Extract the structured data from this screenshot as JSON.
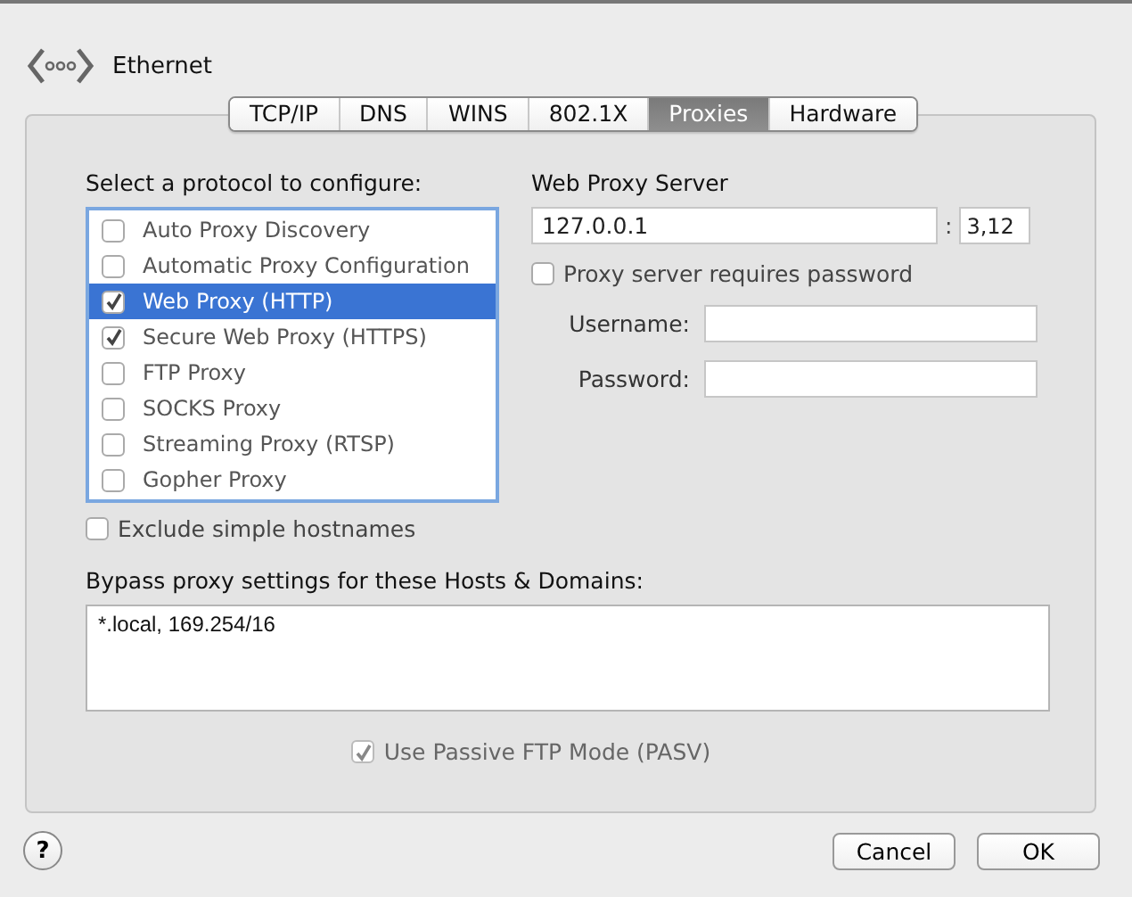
{
  "header": {
    "title": "Ethernet"
  },
  "tabs": [
    {
      "label": "TCP/IP",
      "selected": false
    },
    {
      "label": "DNS",
      "selected": false
    },
    {
      "label": "WINS",
      "selected": false
    },
    {
      "label": "802.1X",
      "selected": false
    },
    {
      "label": "Proxies",
      "selected": true
    },
    {
      "label": "Hardware",
      "selected": false
    }
  ],
  "protocols": {
    "label": "Select a protocol to configure:",
    "items": [
      {
        "label": "Auto Proxy Discovery",
        "checked": false,
        "selected": false
      },
      {
        "label": "Automatic Proxy Configuration",
        "checked": false,
        "selected": false
      },
      {
        "label": "Web Proxy (HTTP)",
        "checked": true,
        "selected": true
      },
      {
        "label": "Secure Web Proxy (HTTPS)",
        "checked": true,
        "selected": false
      },
      {
        "label": "FTP Proxy",
        "checked": false,
        "selected": false
      },
      {
        "label": "SOCKS Proxy",
        "checked": false,
        "selected": false
      },
      {
        "label": "Streaming Proxy (RTSP)",
        "checked": false,
        "selected": false
      },
      {
        "label": "Gopher Proxy",
        "checked": false,
        "selected": false
      }
    ]
  },
  "exclude_simple": {
    "label": "Exclude simple hostnames",
    "checked": false
  },
  "server": {
    "title": "Web Proxy Server",
    "host": "127.0.0.1",
    "separator": ":",
    "port": "3,12",
    "password_required": {
      "label": "Proxy server requires password",
      "checked": false
    },
    "username_label": "Username:",
    "password_label": "Password:"
  },
  "bypass": {
    "label": "Bypass proxy settings for these Hosts & Domains:",
    "value": "*.local, 169.254/16"
  },
  "passive_ftp": {
    "label": "Use Passive FTP Mode (PASV)",
    "checked": true,
    "disabled": true
  },
  "help": "?",
  "buttons": [
    "Cancel",
    "OK"
  ]
}
